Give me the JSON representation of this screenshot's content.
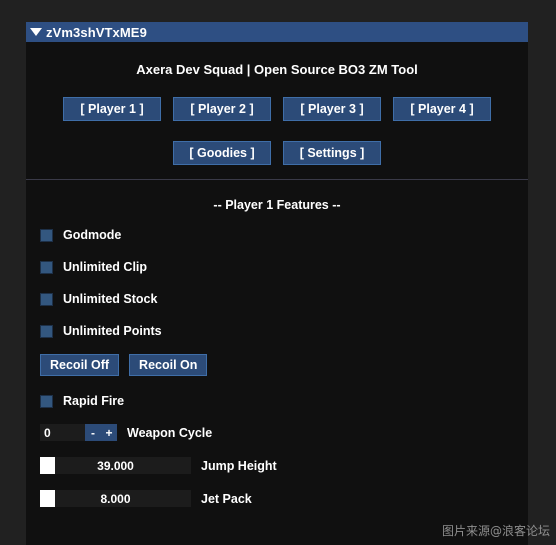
{
  "window": {
    "title": "zVm3shVTxME9",
    "collapse_icon": "triangle-down-icon",
    "subtitle": "Axera Dev Squad | Open Source BO3 ZM Tool",
    "accent_color": "#2e4f83",
    "button_color": "#2c4b78",
    "panel_color": "#101010",
    "desktop_color": "#212121"
  },
  "nav": {
    "row1": [
      {
        "label": "[ Player 1 ]"
      },
      {
        "label": "[ Player 2 ]"
      },
      {
        "label": "[ Player 3 ]"
      },
      {
        "label": "[ Player 4 ]"
      }
    ],
    "row2": [
      {
        "label": "[ Goodies ]"
      },
      {
        "label": "[ Settings ]"
      }
    ]
  },
  "features": {
    "title": "-- Player 1 Features --",
    "checkboxes": [
      {
        "label": "Godmode"
      },
      {
        "label": "Unlimited Clip"
      },
      {
        "label": "Unlimited Stock"
      },
      {
        "label": "Unlimited Points"
      }
    ],
    "recoil": {
      "off_label": "Recoil Off",
      "on_label": "Recoil On"
    },
    "rapid_fire": {
      "label": "Rapid Fire"
    },
    "weapon_cycle": {
      "value": "0",
      "minus": "-",
      "plus": "+",
      "label": "Weapon Cycle"
    },
    "sliders": [
      {
        "value": "39.000",
        "label": "Jump Height"
      },
      {
        "value": "8.000",
        "label": "Jet Pack"
      }
    ]
  },
  "watermark": {
    "text": "图片来源@浪客论坛"
  }
}
